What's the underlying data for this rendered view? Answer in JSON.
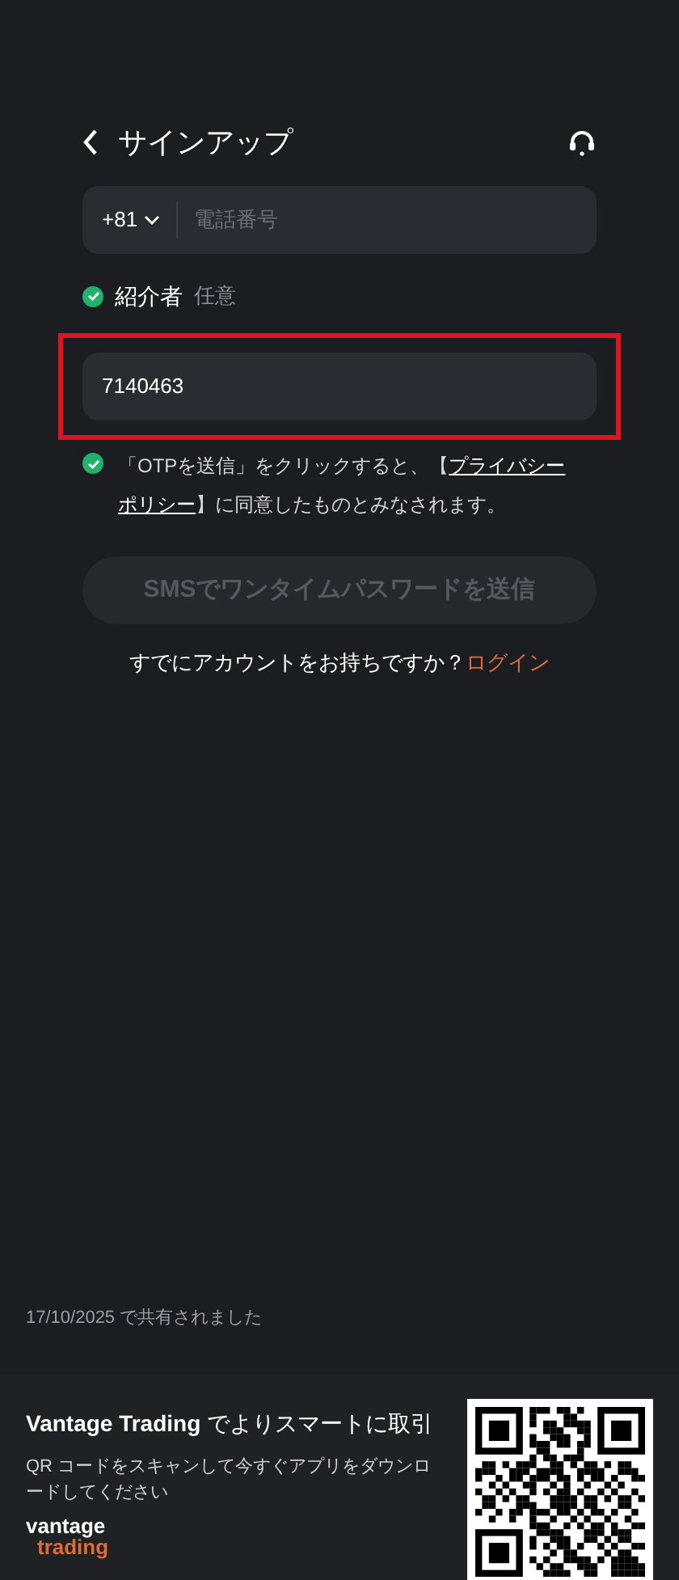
{
  "header": {
    "title": "サインアップ"
  },
  "phone_field": {
    "country_code": "+81",
    "placeholder": "電話番号"
  },
  "referral": {
    "label": "紹介者",
    "hint": "任意",
    "checked": true,
    "value": "7140463",
    "highlighted": true
  },
  "consent": {
    "checked": true,
    "text_before": "「OTPを送信」をクリックすると、【",
    "link_lines": [
      "プライバシー",
      "ポリシー"
    ],
    "text_after": "】に同意したものとみなされます。"
  },
  "send_button": {
    "label": "SMSでワンタイムパスワードを送信",
    "disabled": true
  },
  "login_prompt": {
    "text": "すでにアカウントをお持ちですか？",
    "link": "ログイン"
  },
  "footer": {
    "shared_date": "17/10/2025 で共有されました",
    "headline_brand": "Vantage Trading",
    "headline_rest": " でよりスマートに取引",
    "description": "QR コードをスキャンして今すぐアプリをダウンロードしてください",
    "logo_top": "vantage",
    "logo_bottom": "trading"
  }
}
